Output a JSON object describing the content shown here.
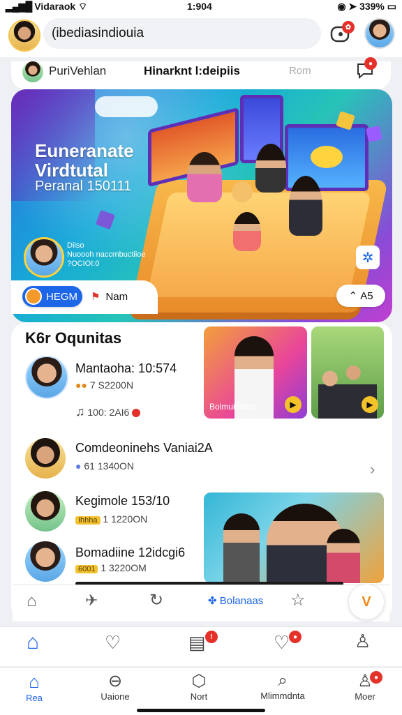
{
  "status": {
    "carrier": "Vidaraok",
    "time": "1:904",
    "battery": "339%"
  },
  "header": {
    "search_text": "(ibediasindiouia",
    "notification_badge": ""
  },
  "subbar": {
    "name": "PuriVehlan",
    "title": "Hinarknt l:deipiis",
    "right_label": "Rom"
  },
  "hero": {
    "title_line1": "Euneranate",
    "title_line2": "Virdtutal",
    "subtitle": "Peranal 150111",
    "card_line1": "Diiso",
    "card_line2": "Nuoooh naccrnbuctiioe",
    "card_line3": "?OCIOI:0",
    "chip1_label": "HEGM",
    "chip2_label": "Nam",
    "right_pill_label": "A5"
  },
  "section": {
    "title": "K6r Oqunitas"
  },
  "rows": [
    {
      "title": "Mantaoha: 10:574",
      "sub": "7 S2200N",
      "extra": "100: 2AI6"
    },
    {
      "title": "Comdeoninehs Vaniai2A",
      "sub": "61 1340ON"
    },
    {
      "title": "Kegimole 153/10",
      "sub": "1 1220ON",
      "chip": "Ihhha"
    },
    {
      "title": "Bomadiine 12idcgi6",
      "sub": "1 3220OM",
      "chip": "6001"
    }
  ],
  "thumbs": {
    "first_caption": "Bolmuinntes"
  },
  "dock": {
    "active_label": "Bolanaas"
  },
  "tabbar2": {
    "labels": [
      "Rea",
      "Uaione",
      "Nort",
      "Mlimmdnta",
      "Moer"
    ]
  },
  "colors": {
    "accent": "#1e66e8",
    "badge": "#e4322b"
  }
}
